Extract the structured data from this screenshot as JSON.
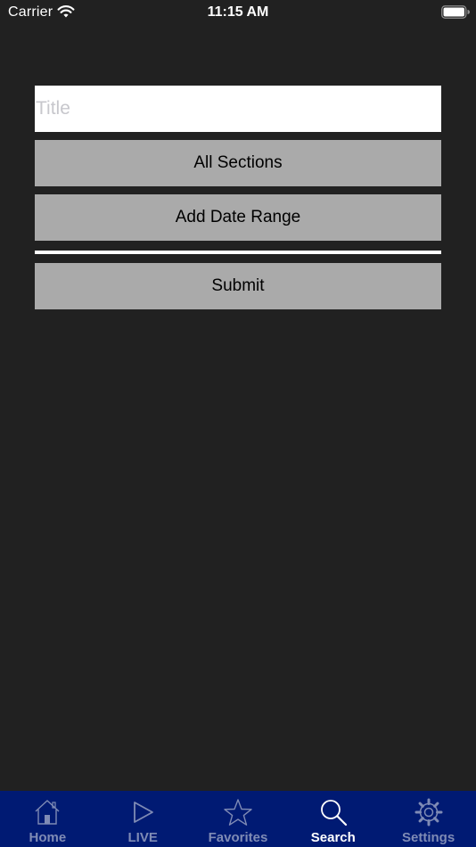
{
  "status_bar": {
    "carrier": "Carrier",
    "time": "11:15 AM"
  },
  "form": {
    "title_placeholder": "Title",
    "title_value": "",
    "sections_button": "All Sections",
    "date_range_button": "Add Date Range",
    "submit_button": "Submit"
  },
  "tab_bar": {
    "tabs": [
      {
        "label": "Home",
        "icon": "home-icon",
        "active": false
      },
      {
        "label": "LIVE",
        "icon": "play-icon",
        "active": false
      },
      {
        "label": "Favorites",
        "icon": "star-icon",
        "active": false
      },
      {
        "label": "Search",
        "icon": "search-icon",
        "active": true
      },
      {
        "label": "Settings",
        "icon": "gear-icon",
        "active": false
      }
    ]
  },
  "colors": {
    "background": "#212121",
    "button": "#aaaaaa",
    "tab_bar": "#001a73",
    "tab_inactive": "#7f8bb5",
    "tab_active": "#ffffff"
  }
}
